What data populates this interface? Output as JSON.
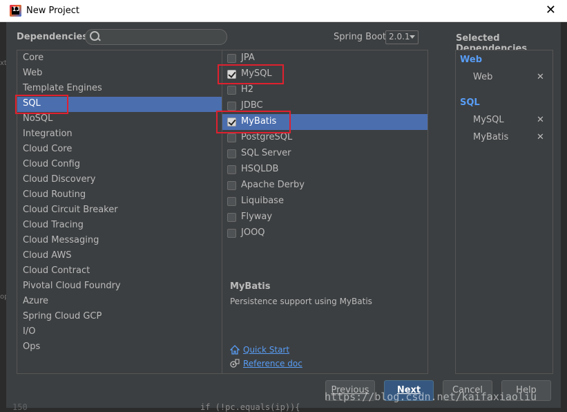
{
  "window": {
    "title": "New Project"
  },
  "header": {
    "dependencies_label": "Dependencies",
    "search_placeholder": "",
    "spring_boot_label": "Spring Boot",
    "spring_boot_version": "2.0.1",
    "selected_title": "Selected Dependencies"
  },
  "categories": [
    "Core",
    "Web",
    "Template Engines",
    "SQL",
    "NoSQL",
    "Integration",
    "Cloud Core",
    "Cloud Config",
    "Cloud Discovery",
    "Cloud Routing",
    "Cloud Circuit Breaker",
    "Cloud Tracing",
    "Cloud Messaging",
    "Cloud AWS",
    "Cloud Contract",
    "Pivotal Cloud Foundry",
    "Azure",
    "Spring Cloud GCP",
    "I/O",
    "Ops"
  ],
  "selected_category": "SQL",
  "dependencies": [
    {
      "label": "JPA",
      "checked": false
    },
    {
      "label": "MySQL",
      "checked": true
    },
    {
      "label": "H2",
      "checked": false
    },
    {
      "label": "JDBC",
      "checked": false
    },
    {
      "label": "MyBatis",
      "checked": true
    },
    {
      "label": "PostgreSQL",
      "checked": false
    },
    {
      "label": "SQL Server",
      "checked": false
    },
    {
      "label": "HSQLDB",
      "checked": false
    },
    {
      "label": "Apache Derby",
      "checked": false
    },
    {
      "label": "Liquibase",
      "checked": false
    },
    {
      "label": "Flyway",
      "checked": false
    },
    {
      "label": "JOOQ",
      "checked": false
    }
  ],
  "highlighted_dependency": "MyBatis",
  "description": {
    "title": "MyBatis",
    "text": "Persistence support using MyBatis",
    "quick_start": "Quick Start",
    "reference_doc": "Reference doc"
  },
  "selected": [
    {
      "group": "Web",
      "items": [
        "Web"
      ]
    },
    {
      "group": "SQL",
      "items": [
        "MySQL",
        "MyBatis"
      ]
    }
  ],
  "buttons": {
    "previous": "Previous",
    "next": "Next",
    "cancel": "Cancel",
    "help": "Help"
  },
  "background": {
    "line_number": "150",
    "code": "if (!pc.equals(ip)){",
    "side_a": "xt",
    "side_b": "op"
  },
  "watermark": "https://blog.csdn.net/kaifaxiaoliu",
  "colors": {
    "selection": "#4b6eaf",
    "link": "#589df6",
    "primary_button": "#365880",
    "annotation_box": "#e0202f"
  }
}
